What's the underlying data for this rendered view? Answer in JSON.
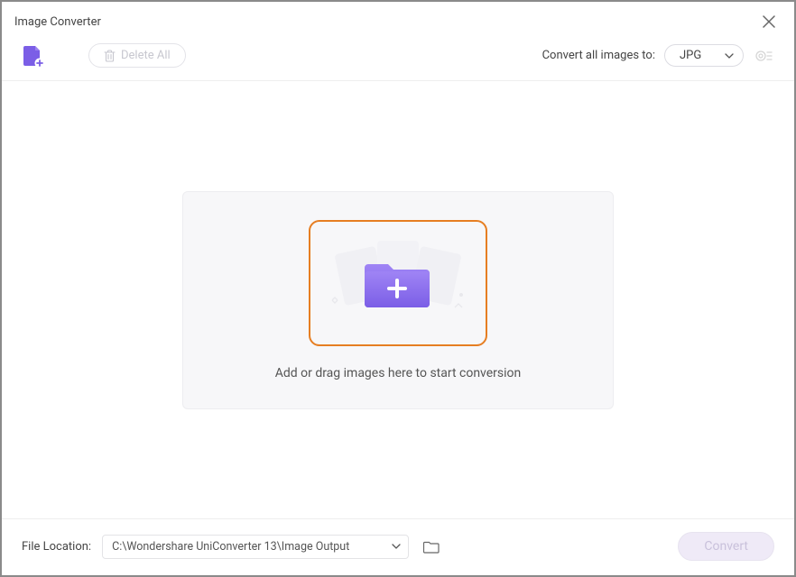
{
  "window": {
    "title": "Image Converter"
  },
  "toolbar": {
    "delete_all_label": "Delete All",
    "convert_all_label": "Convert all images to:",
    "format_selected": "JPG"
  },
  "dropzone": {
    "instruction": "Add or drag images here to start conversion"
  },
  "footer": {
    "file_location_label": "File Location:",
    "path": "C:\\Wondershare UniConverter 13\\Image Output",
    "convert_label": "Convert"
  }
}
